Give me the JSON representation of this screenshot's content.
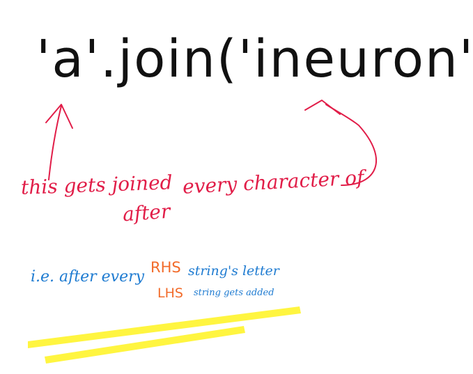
{
  "code": "'a'.join('ineuron')",
  "notes": {
    "line1": "this gets joined",
    "line2": "every character of",
    "line3": "after",
    "ie_prefix": "i.e. after every",
    "rhs": "RHS",
    "rhs_rest": "string's letter",
    "lhs": "LHS",
    "lhs_rest": "string gets added"
  },
  "colors": {
    "ink": "#111111",
    "red": "#e11d48",
    "blue": "#1e7bd1",
    "orange": "#f26b2a",
    "highlighter": "#fff200"
  }
}
